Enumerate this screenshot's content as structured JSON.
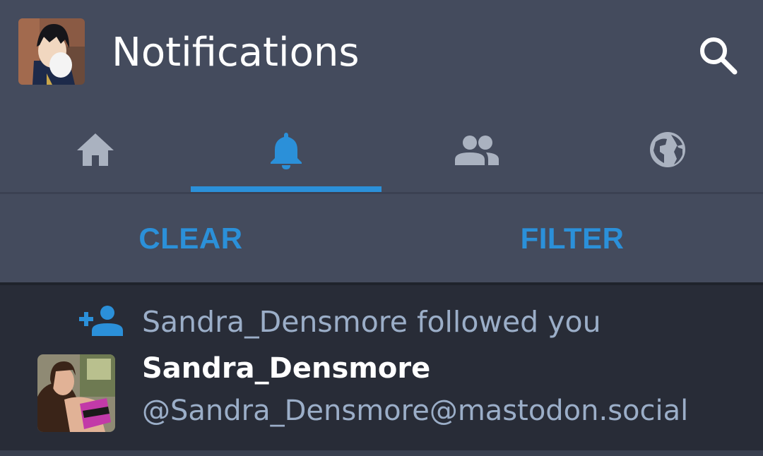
{
  "header": {
    "title": "Notifications",
    "avatar_icon": "user-avatar",
    "search_icon": "search-icon"
  },
  "tabs": [
    {
      "icon": "home-icon",
      "active": false
    },
    {
      "icon": "bell-icon",
      "active": true
    },
    {
      "icon": "people-icon",
      "active": false
    },
    {
      "icon": "globe-icon",
      "active": false
    }
  ],
  "actions": {
    "clear_label": "CLEAR",
    "filter_label": "FILTER"
  },
  "notifications": [
    {
      "type_icon": "person-add-icon",
      "message": "Sandra_Densmore followed you",
      "display_name": "Sandra_Densmore",
      "account": "@Sandra_Densmore@mastodon.social"
    }
  ],
  "colors": {
    "header_bg": "#444b5d",
    "content_bg": "#282c37",
    "accent": "#2b90d9",
    "muted_text": "#9baec8",
    "inactive_icon": "#aab2c0"
  }
}
